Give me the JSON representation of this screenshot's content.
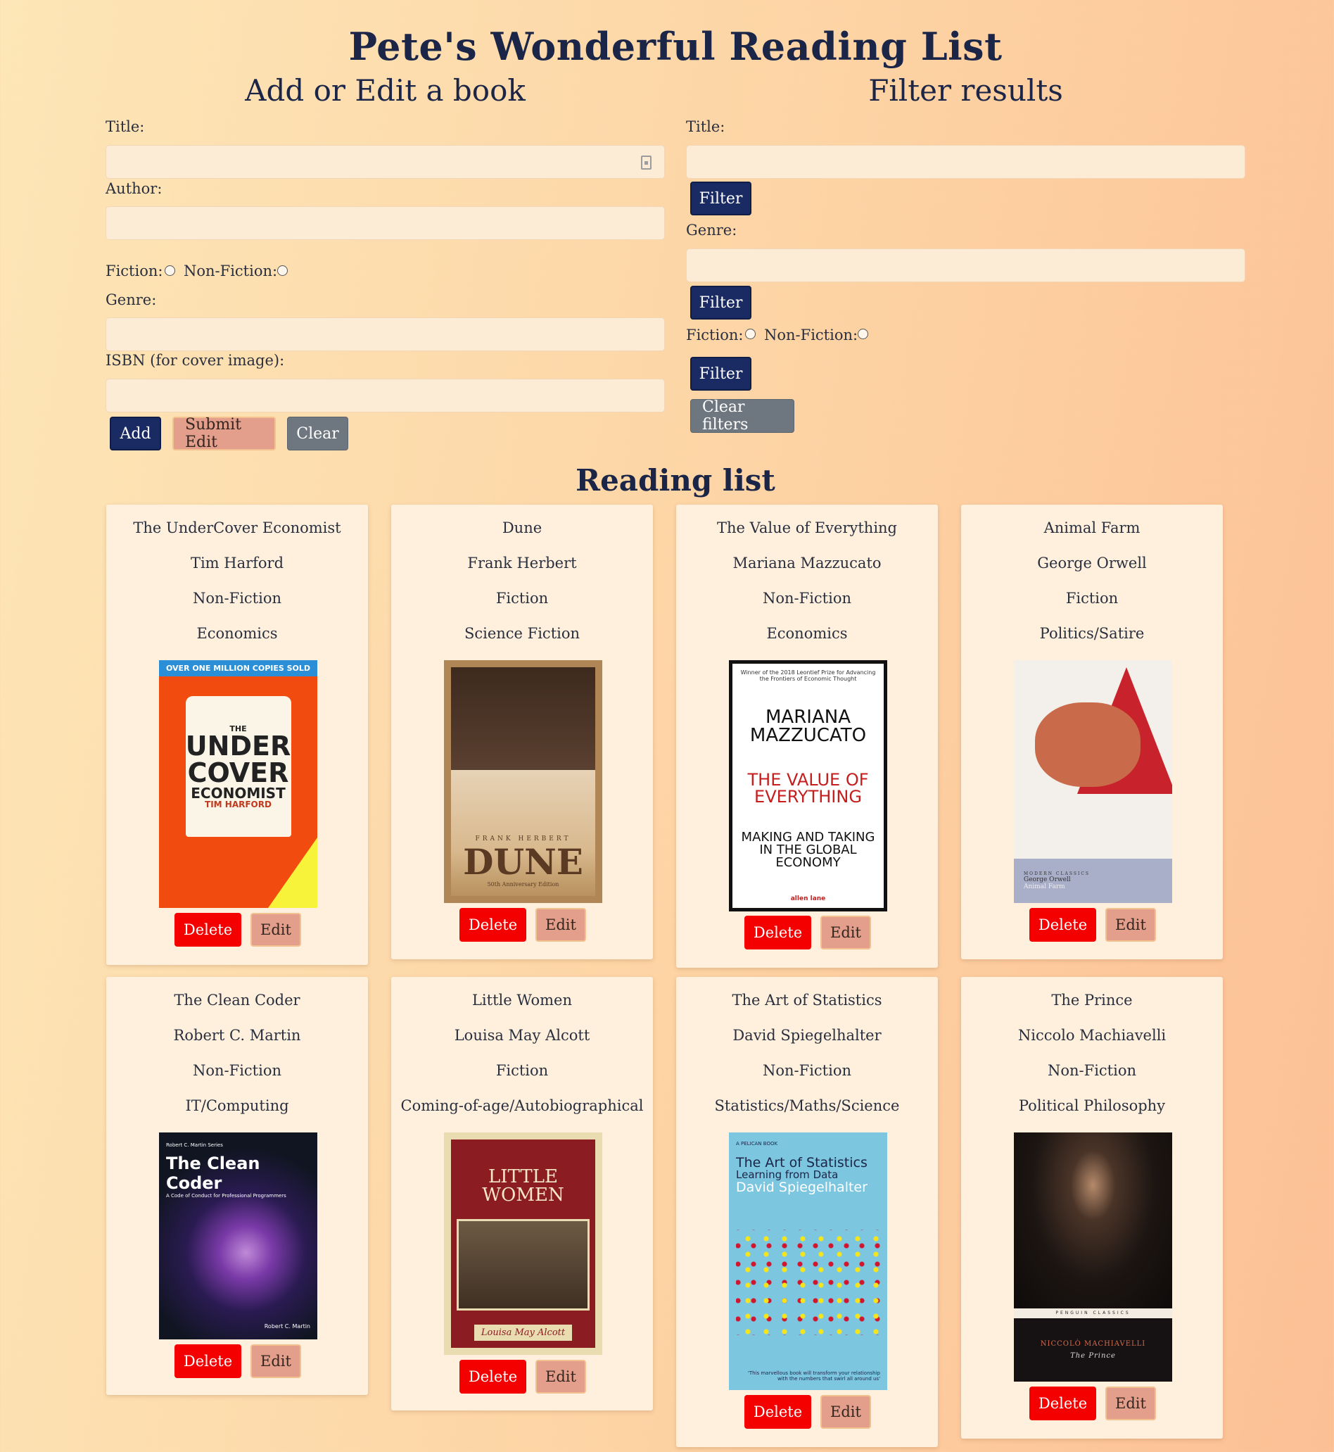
{
  "page_title": "Pete's Wonderful Reading List",
  "add_section": {
    "heading": "Add or Edit a book",
    "title_label": "Title:",
    "author_label": "Author:",
    "fiction_label": "Fiction:",
    "nonfiction_label": "Non-Fiction:",
    "genre_label": "Genre:",
    "isbn_label": "ISBN (for cover image):",
    "add_button": "Add",
    "submit_edit_button": "Submit Edit",
    "clear_button": "Clear"
  },
  "filter_section": {
    "heading": "Filter results",
    "title_label": "Title:",
    "genre_label": "Genre:",
    "fiction_label": "Fiction:",
    "nonfiction_label": "Non-Fiction:",
    "filter_button": "Filter",
    "clear_filters_button": "Clear filters"
  },
  "reading_list_heading": "Reading list",
  "delete_label": "Delete",
  "edit_label": "Edit",
  "books": [
    {
      "title": "The UnderCover Economist",
      "author": "Tim Harford",
      "type": "Non-Fiction",
      "genre": "Economics",
      "cover": {
        "top": "OVER ONE MILLION COPIES SOLD",
        "t1": "THE",
        "t2": "UNDER",
        "t3": "COVER",
        "t4": "ECONOMIST",
        "t5": "TIM HARFORD",
        "bg": "#f24b10"
      }
    },
    {
      "title": "Dune",
      "author": "Frank Herbert",
      "type": "Fiction",
      "genre": "Science Fiction",
      "cover": {
        "t1": "FRANK HERBERT",
        "t2": "DUNE",
        "t3": "50th Anniversary Edition",
        "bg": "#b08656"
      }
    },
    {
      "title": "The Value of Everything",
      "author": "Mariana Mazzucato",
      "type": "Non-Fiction",
      "genre": "Economics",
      "cover": {
        "t1": "Winner of the 2018 Leontief Prize for Advancing the Frontiers of Economic Thought",
        "t2": "MARIANA MAZZUCATO",
        "t3": "THE VALUE OF EVERYTHING",
        "t4": "MAKING AND TAKING IN THE GLOBAL ECONOMY",
        "t5": "allen lane",
        "bg": "#ffffff"
      }
    },
    {
      "title": "Animal Farm",
      "author": "George Orwell",
      "type": "Fiction",
      "genre": "Politics/Satire",
      "cover": {
        "t1": "MODERN CLASSICS",
        "t2": "George Orwell",
        "t3": "Animal Farm",
        "bg": "#f3efea"
      }
    },
    {
      "title": "The Clean Coder",
      "author": "Robert C. Martin",
      "type": "Non-Fiction",
      "genre": "IT/Computing",
      "cover": {
        "t1": "Robert C. Martin Series",
        "t2": "The Clean Coder",
        "t3": "A Code of Conduct for Professional Programmers",
        "t4": "Robert C. Martin",
        "bg": "#111522"
      }
    },
    {
      "title": "Little Women",
      "author": "Louisa May Alcott",
      "type": "Fiction",
      "genre": "Coming-of-age/Autobiographical",
      "cover": {
        "t1": "LITTLE WOMEN",
        "t2": "Louisa May Alcott",
        "bg": "#8a1c22"
      }
    },
    {
      "title": "The Art of Statistics",
      "author": "David Spiegelhalter",
      "type": "Non-Fiction",
      "genre": "Statistics/Maths/Science",
      "cover": {
        "t1": "A PELICAN BOOK",
        "t2": "The Art of Statistics",
        "t3": "Learning from Data",
        "t4": "David Spiegelhalter",
        "t5": "'This marvellous book will transform your relationship with the numbers that swirl all around us'",
        "bg": "#7cc6e0"
      }
    },
    {
      "title": "The Prince",
      "author": "Niccolo Machiavelli",
      "type": "Non-Fiction",
      "genre": "Political Philosophy",
      "cover": {
        "t1": "PENGUIN CLASSICS",
        "t2": "NICCOLÒ MACHIAVELLI",
        "t3": "The Prince",
        "bg": "#2a1d18"
      }
    }
  ]
}
